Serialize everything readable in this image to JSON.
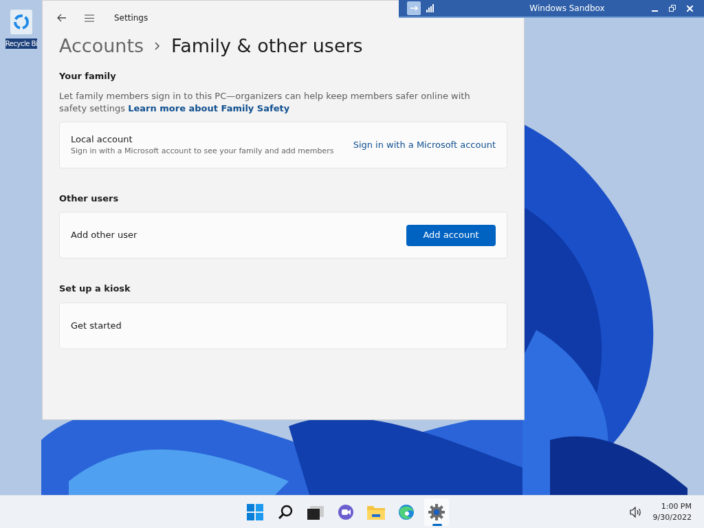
{
  "desktop": {
    "icons": [
      {
        "label": "Recycle Bi"
      }
    ]
  },
  "sandbox_bar": {
    "title": "Windows Sandbox"
  },
  "settings": {
    "app_title": "Settings",
    "breadcrumb": [
      "Accounts",
      "Family & other users"
    ],
    "sections": [
      {
        "heading": "Your family",
        "description": "Let family members sign in to this PC—organizers can help keep members safer online with safety settings",
        "link": "Learn more about Family Safety",
        "card": {
          "title": "Local account",
          "subtitle": "Sign in with a Microsoft account to see your family and add members",
          "action": {
            "kind": "link",
            "label": "Sign in with a Microsoft account"
          }
        }
      },
      {
        "heading": "Other users",
        "card": {
          "title": "Add other user",
          "action": {
            "kind": "button",
            "label": "Add account"
          }
        }
      },
      {
        "heading": "Set up a kiosk",
        "card": {
          "title": "Get started"
        }
      }
    ]
  },
  "taskbar": {
    "apps": [
      {
        "kind": "start",
        "selected": false
      },
      {
        "kind": "search",
        "selected": false
      },
      {
        "kind": "taskview",
        "selected": false
      },
      {
        "kind": "chat",
        "selected": false
      },
      {
        "kind": "explorer",
        "selected": false
      },
      {
        "kind": "edge",
        "selected": false
      },
      {
        "kind": "settings",
        "selected": true
      }
    ],
    "time": "1:00 PM",
    "date": "9/30/2022"
  }
}
